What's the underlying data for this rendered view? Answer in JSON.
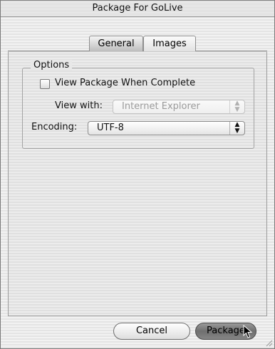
{
  "window": {
    "title": "Package For GoLive"
  },
  "tabs": [
    {
      "label": "General",
      "selected": true
    },
    {
      "label": "Images",
      "selected": false
    }
  ],
  "options": {
    "group_label": "Options",
    "view_package_label": "View Package When Complete",
    "view_package_checked": false,
    "view_with_label": "View with:",
    "view_with_value": "Internet Explorer",
    "view_with_enabled": false,
    "encoding_label": "Encoding:",
    "encoding_value": "UTF-8"
  },
  "buttons": {
    "cancel_label": "Cancel",
    "package_label": "Package"
  }
}
